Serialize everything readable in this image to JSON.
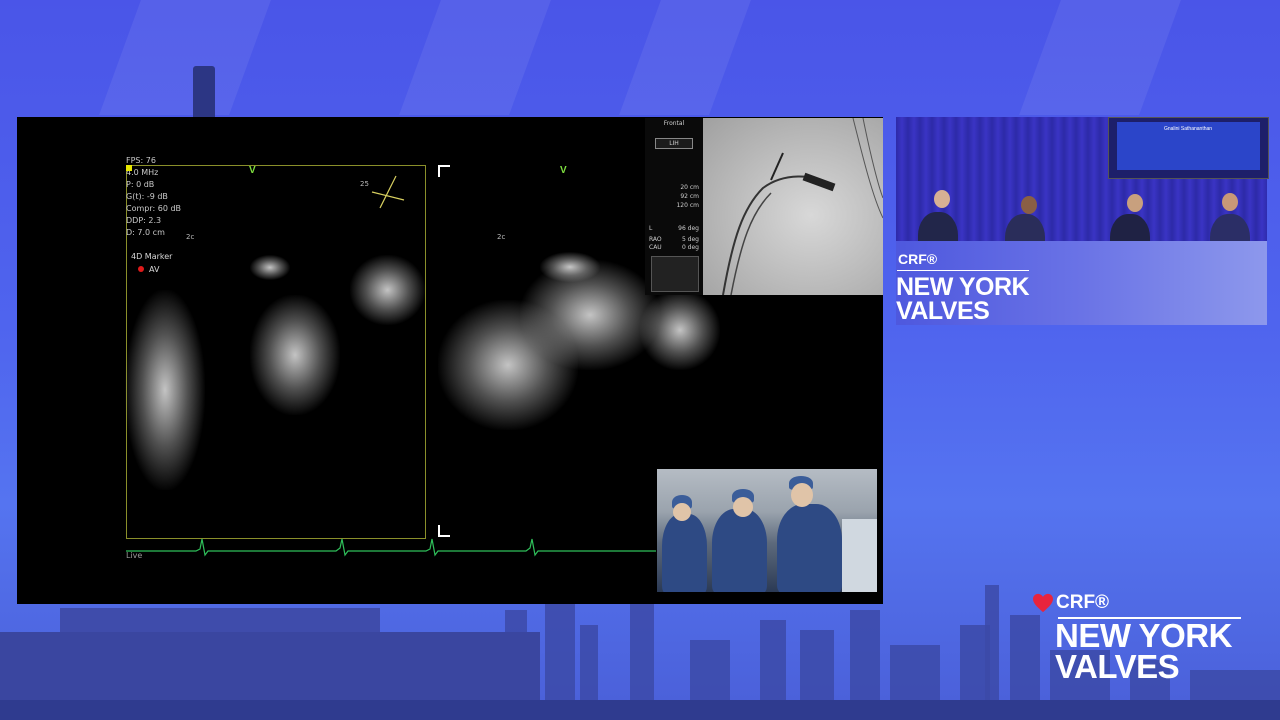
{
  "echo": {
    "info_lines": [
      "FPS: 76",
      "4.0 MHz",
      "P: 0 dB",
      "G(t): -9 dB",
      "Compr: 60 dB",
      "DDP: 2.3",
      "D: 7.0 cm"
    ],
    "marker_title": "4D Marker",
    "marker_item": "AV",
    "v_mark": "V",
    "scale_a": "2c",
    "scale_b": "2c",
    "angle": "25",
    "live_label": "Live"
  },
  "fluoro_panel": {
    "top_label": "Frontal",
    "lih": "LIH",
    "depth_1": "20 cm",
    "depth_2": "92 cm",
    "depth_3": "120 cm",
    "l_label": "L",
    "l_value": "96 deg",
    "rao_label": "RAO",
    "rao_value": "5 deg",
    "cau_label": "CAU",
    "cau_value": "0 deg"
  },
  "panel": {
    "speaker_name": "Gnalini Sathananthan",
    "crf": "CRF®",
    "title_line1": "NEW YORK",
    "title_line2": "VALVES"
  },
  "brand": {
    "crf": "CRF®",
    "title_line1": "NEW YORK",
    "title_line2": "VALVES",
    "heart_color": "#e8243c"
  }
}
